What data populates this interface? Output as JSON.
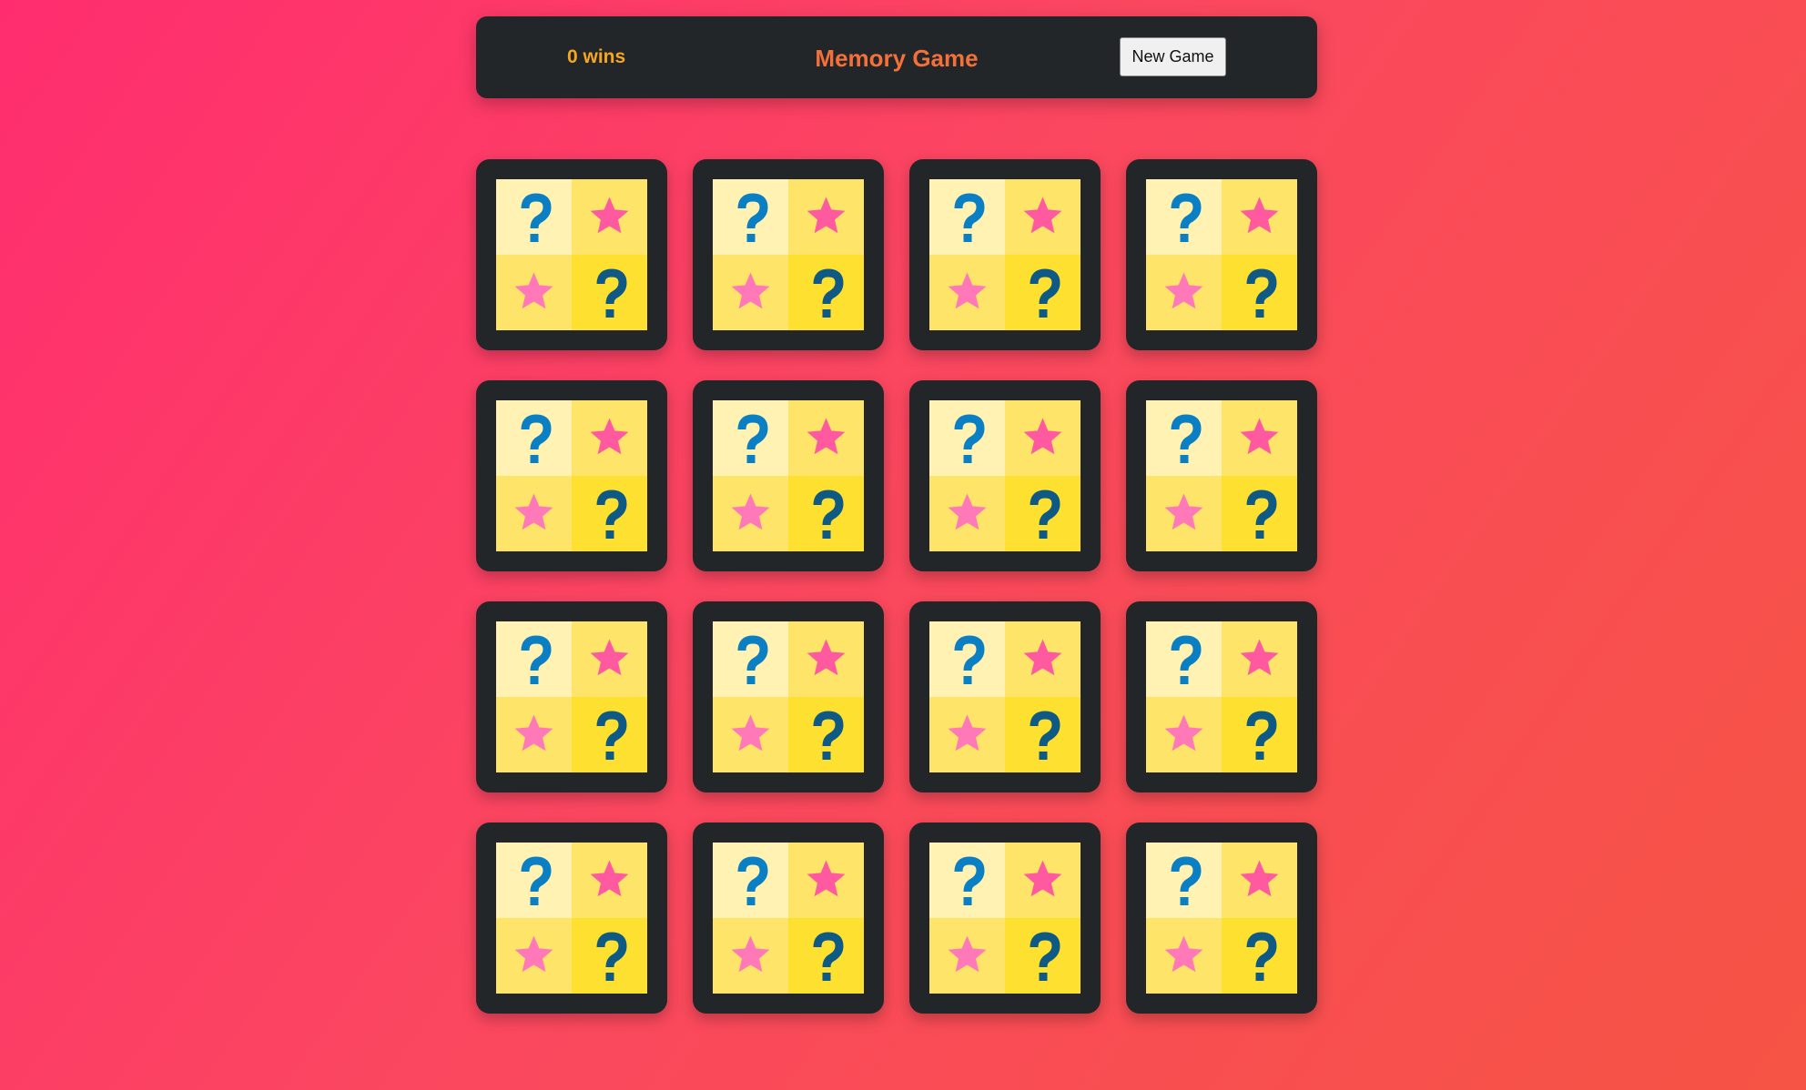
{
  "header": {
    "wins_label": "0 wins",
    "title": "Memory Game",
    "new_game_label": "New Game"
  },
  "colors": {
    "header_bg": "#222629",
    "wins_text": "#f6a623",
    "title_text": "#f4703b",
    "card_frame": "#222629",
    "tile_light": "#fff2b2",
    "tile_mid": "#ffe46a",
    "tile_dark": "#fde030",
    "question_blue": "#0a7fc4",
    "question_dark_blue": "#0e5a85",
    "star_pink": "#ff5aa0",
    "star_light_pink": "#ff78b8"
  },
  "board": {
    "rows": 4,
    "columns": 4,
    "card_back_icon": "question-star-tile-icon",
    "cards": [
      {
        "state": "face-down"
      },
      {
        "state": "face-down"
      },
      {
        "state": "face-down"
      },
      {
        "state": "face-down"
      },
      {
        "state": "face-down"
      },
      {
        "state": "face-down"
      },
      {
        "state": "face-down"
      },
      {
        "state": "face-down"
      },
      {
        "state": "face-down"
      },
      {
        "state": "face-down"
      },
      {
        "state": "face-down"
      },
      {
        "state": "face-down"
      },
      {
        "state": "face-down"
      },
      {
        "state": "face-down"
      },
      {
        "state": "face-down"
      },
      {
        "state": "face-down"
      }
    ]
  }
}
